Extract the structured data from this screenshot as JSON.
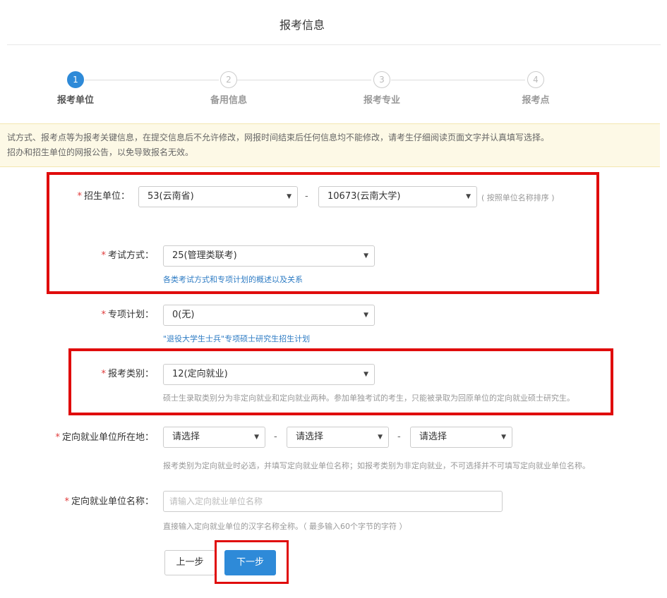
{
  "page_title": "报考信息",
  "steps": [
    {
      "number": "1",
      "label": "报考单位",
      "active": true
    },
    {
      "number": "2",
      "label": "备用信息",
      "active": false
    },
    {
      "number": "3",
      "label": "报考专业",
      "active": false
    },
    {
      "number": "4",
      "label": "报考点",
      "active": false
    }
  ],
  "notice": {
    "line1": "试方式、报考点等为报考关键信息，在提交信息后不允许修改，网报时间结束后任何信息均不能修改，请考生仔细阅读页面文字并认真填写选择。",
    "line2": "招办和招生单位的网报公告，以免导致报名无效。"
  },
  "required_mark": "*",
  "recruiting_unit": {
    "label": "招生单位：",
    "province_value": "53(云南省)",
    "separator": "-",
    "unit_value": "10673(云南大学)",
    "note": "( 按照单位名称排序 )"
  },
  "exam_method": {
    "label": "考试方式：",
    "value": "25(管理类联考)",
    "link": "各类考试方式和专项计划的概述以及关系"
  },
  "special_plan": {
    "label": "专项计划：",
    "value": "0(无)",
    "link": "\"退役大学生士兵\"专项硕士研究生招生计划"
  },
  "application_category": {
    "label": "报考类别：",
    "value": "12(定向就业)",
    "hint": "硕士生录取类别分为非定向就业和定向就业两种。参加单独考试的考生，只能被录取为回原单位的定向就业硕士研究生。"
  },
  "employer_location": {
    "label": "定向就业单位所在地：",
    "select1": "请选择",
    "select2": "请选择",
    "select3": "请选择",
    "separator": "-",
    "hint": "报考类别为定向就业时必选，并填写定向就业单位名称；如报考类别为非定向就业，不可选择并不可填写定向就业单位名称。"
  },
  "employer_name": {
    "label": "定向就业单位名称：",
    "placeholder": "请输入定向就业单位名称",
    "value": "",
    "hint": "直接输入定向就业单位的汉字名称全称。（ 最多输入60个字节的字符 ）"
  },
  "buttons": {
    "prev": "上一步",
    "next": "下一步"
  },
  "icons": {
    "dropdown": "caret-down-icon"
  },
  "colors": {
    "accent": "#2e8ad8",
    "link": "#2e7cc4",
    "required": "#e03a3a",
    "annotation": "#e00c0c",
    "notice_bg": "#fdf9e6"
  }
}
